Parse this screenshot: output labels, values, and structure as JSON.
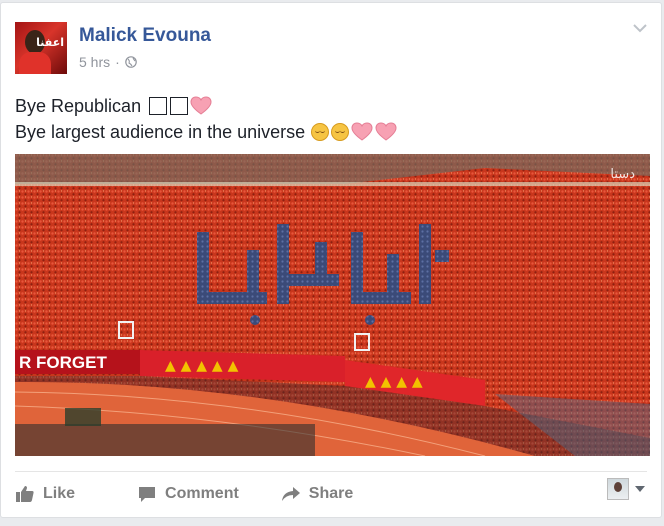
{
  "post": {
    "author": "Malick Evouna",
    "time": "5 hrs",
    "separator": "·",
    "line1": "Bye Republican",
    "line2": "Bye largest audience in the universe",
    "line1_emoji": [
      "1F640-box",
      "1F630-box",
      "pink-heart"
    ],
    "line2_emoji": [
      "pensive-face",
      "relieved-face",
      "pink-heart",
      "pink-heart"
    ],
    "avatar_label": "اعفنا"
  },
  "photo": {
    "banner_text": "R FORGET",
    "watermark": "دستا",
    "colors": {
      "crowd": "#c8361c",
      "pitch": "#e0643a",
      "mosaic": "#3b4a78"
    }
  },
  "actions": {
    "like": "Like",
    "comment": "Comment",
    "share": "Share"
  },
  "colors": {
    "author": "#365899",
    "meta": "#90949c",
    "action": "#7f7f7f",
    "heart": "#f7a1b3"
  }
}
